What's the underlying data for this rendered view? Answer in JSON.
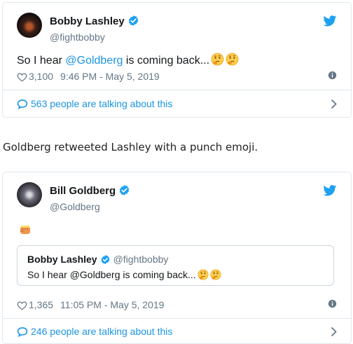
{
  "tweet1": {
    "author_name": "Bobby Lashley",
    "author_handle": "@fightbobby",
    "text_prefix": "So I hear ",
    "mention": "@Goldberg",
    "text_suffix": " is coming back...",
    "emojis": [
      "thinking-face",
      "thinking-face"
    ],
    "likes": "3,100",
    "timestamp": "9:46 PM - May 5, 2019",
    "talking": "563 people are talking about this"
  },
  "caption": "Goldberg retweeted Lashley with a punch emoji.",
  "tweet2": {
    "author_name": "Bill Goldberg",
    "author_handle": "@Goldberg",
    "emoji": "oncoming-fist",
    "quoted": {
      "author_name": "Bobby Lashley",
      "author_handle": "@fightbobby",
      "text": "So I hear @Goldberg is coming back...",
      "emojis": [
        "thinking-face",
        "thinking-face"
      ]
    },
    "likes": "1,365",
    "timestamp": "11:05 PM - May 5, 2019",
    "talking": "246 people are talking about this"
  },
  "colors": {
    "link_blue": "#1b95e0",
    "twitter_blue": "#1da1f2",
    "muted_gray": "#657786",
    "border": "#e1e8ed"
  }
}
